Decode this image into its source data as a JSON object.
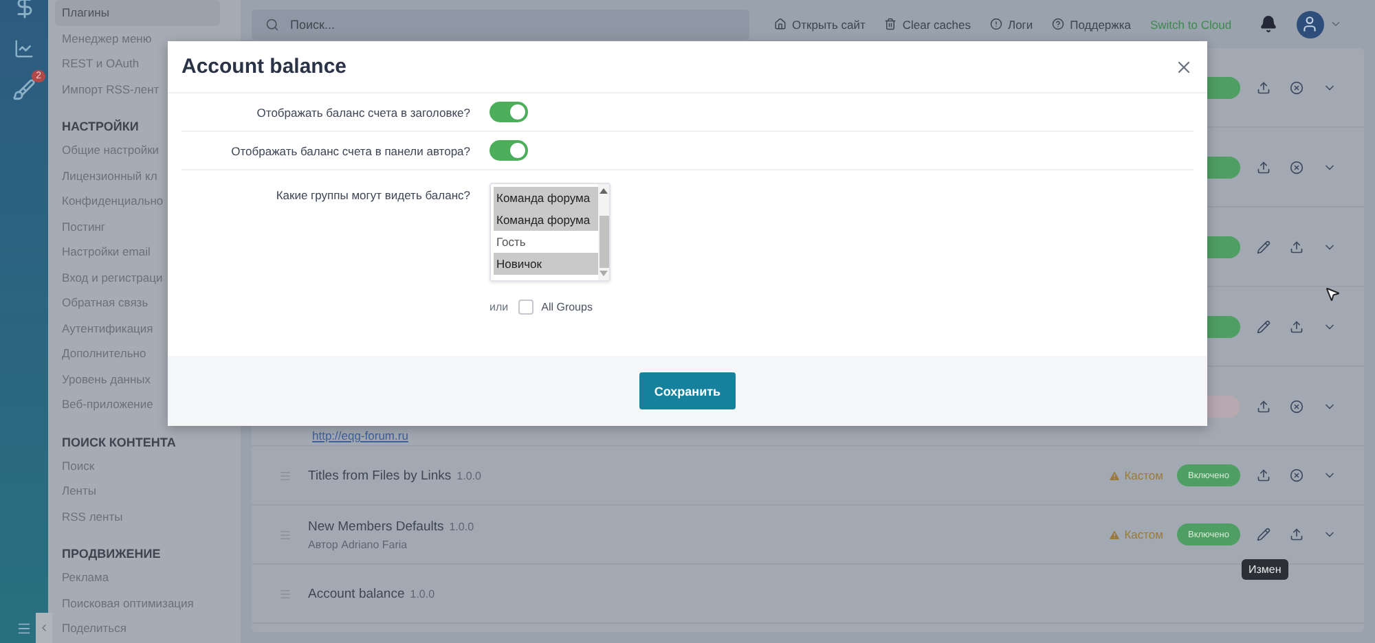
{
  "rail": {
    "badge": "2"
  },
  "sidebar": {
    "items": [
      {
        "label": "Плагины",
        "selected": true
      },
      {
        "label": "Менеджер меню",
        "selected": false
      },
      {
        "label": "REST и OAuth",
        "selected": false
      },
      {
        "label": "Импорт RSS-лент",
        "selected": false
      }
    ],
    "sections": [
      {
        "title": "НАСТРОЙКИ",
        "items": [
          "Общие настройки",
          "Лицензионный кл",
          "Конфиденциально",
          "Постинг",
          "Настройки email",
          "Вход и регистраци",
          "Обратная связь",
          "Аутентификация",
          "Дополнительно",
          "Уровень данных",
          "Веб-приложение"
        ]
      },
      {
        "title": "ПОИСК КОНТЕНТА",
        "items": [
          "Поиск",
          "Ленты",
          "RSS ленты"
        ]
      },
      {
        "title": "ПРОДВИЖЕНИЕ",
        "items": [
          "Реклама",
          "Поисковая оптимизация",
          "Поделиться"
        ]
      }
    ]
  },
  "topbar": {
    "search": {
      "placeholder": "Поиск..."
    },
    "links": [
      {
        "kind": "home",
        "label": "Открыть сайт"
      },
      {
        "kind": "trash",
        "label": "Clear caches"
      },
      {
        "kind": "alert",
        "label": "Логи"
      },
      {
        "kind": "help",
        "label": "Поддержка"
      },
      {
        "kind": "cloud",
        "label": "Switch to Cloud"
      }
    ]
  },
  "plugins": [
    {
      "kind": "covered",
      "enabled": true,
      "editable": false
    },
    {
      "kind": "covered",
      "enabled": true,
      "editable": false
    },
    {
      "kind": "covered",
      "enabled": true,
      "editable": true
    },
    {
      "kind": "covered",
      "enabled": true,
      "editable": true
    },
    {
      "kind": "covered",
      "enabled": false,
      "link": "http://eqg-forum.ru",
      "editable": false
    },
    {
      "kind": "full",
      "name": "Titles from Files by Links",
      "version": "1.0.0",
      "flag": "Кастом",
      "status": "Включено",
      "enabled": true,
      "editable": false
    },
    {
      "kind": "full",
      "name": "New Members Defaults",
      "version": "1.0.0",
      "author": "Автор Adriano Faria",
      "flag": "Кастом",
      "status": "Включено",
      "enabled": true,
      "editable": true
    },
    {
      "kind": "full",
      "name": "Account balance",
      "version": "1.0.0"
    }
  ],
  "tooltip": "Измен",
  "modal": {
    "title": "Account balance",
    "fields": [
      {
        "kind": "toggle",
        "label": "Отображать баланс счета в заголовке?",
        "on": true
      },
      {
        "kind": "toggle",
        "label": "Отображать баланс счета в панели автора?",
        "on": true
      },
      {
        "kind": "listbox",
        "label": "Какие группы могут видеть баланс?",
        "options": [
          {
            "label": "Команда форума",
            "selected": true
          },
          {
            "label": "Команда форума",
            "selected": true
          },
          {
            "label": "Гость",
            "selected": false
          },
          {
            "label": "Новичок",
            "selected": true
          }
        ],
        "or": "или",
        "all": {
          "label": "All Groups",
          "checked": false
        }
      }
    ],
    "button": "Сохранить"
  }
}
